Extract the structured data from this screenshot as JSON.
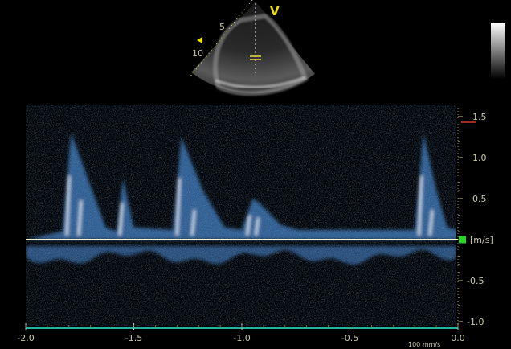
{
  "echo_view": {
    "depth_labels": [
      "5",
      "10"
    ],
    "orientation_marker": "V"
  },
  "doppler": {
    "velocity_unit": "[m/s]",
    "speed_label": "100 mm/s",
    "y_ticks": [
      "1.5",
      "1.0",
      "0.5",
      "-0.5",
      "-1.0"
    ],
    "x_ticks": [
      "-2.0",
      "-1.5",
      "-1.0",
      "-0.5",
      "0.0"
    ],
    "colors": {
      "spectrum": "#5aa8ff",
      "axis": "#c9c9a9",
      "baseline": "#f4f0d0",
      "cursor": "#28d428",
      "scale_line": "#1fb3a0",
      "limit_tick": "#e03030"
    }
  },
  "chart_data": {
    "type": "area",
    "title": "",
    "xlabel": "",
    "ylabel": "[m/s]",
    "xlim": [
      -2.0,
      0.0
    ],
    "ylim": [
      -1.0,
      1.5
    ],
    "series": [
      {
        "x": [
          -1.83,
          -1.79,
          -1.72,
          -1.63,
          -1.58,
          -1.55,
          -1.5,
          -1.32,
          -1.28,
          -1.18,
          -1.08,
          -1.0,
          -0.95,
          -0.92,
          -0.82,
          -0.74,
          -0.2,
          -0.16,
          -0.1,
          -0.05
        ],
        "values": [
          0.1,
          1.3,
          0.8,
          0.15,
          0.1,
          0.75,
          0.15,
          0.12,
          1.25,
          0.6,
          0.15,
          0.12,
          0.5,
          0.45,
          0.18,
          0.12,
          0.12,
          1.3,
          0.6,
          0.15
        ]
      }
    ]
  }
}
